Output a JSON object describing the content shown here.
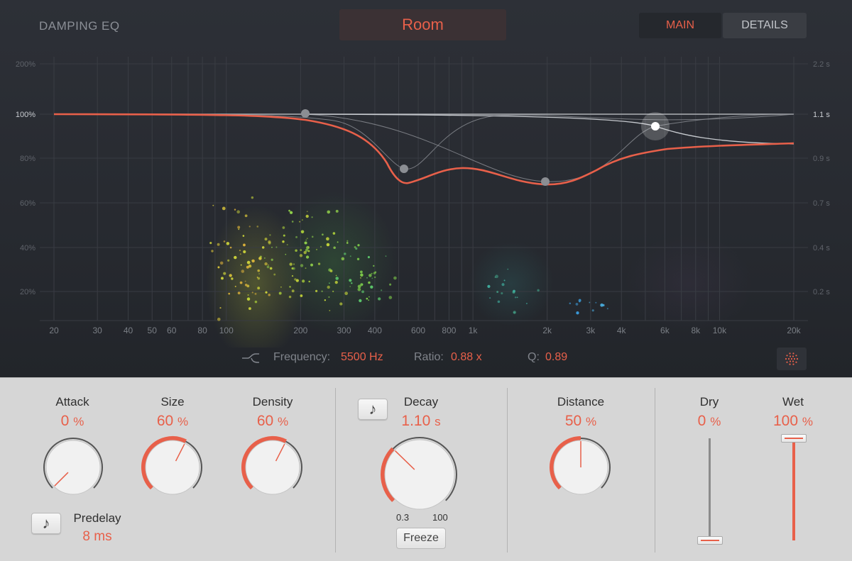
{
  "header": {
    "section_label": "DAMPING EQ",
    "preset_name": "Room",
    "tabs": [
      {
        "label": "MAIN",
        "active": true
      },
      {
        "label": "DETAILS",
        "active": false
      }
    ]
  },
  "eq_display": {
    "y_left_ticks": [
      "200%",
      "100%",
      "80%",
      "60%",
      "40%",
      "20%"
    ],
    "y_right_ticks": [
      "2.2 s",
      "1.1 s",
      "0.9 s",
      "0.7 s",
      "0.4 s",
      "0.2 s"
    ],
    "x_ticks": [
      "20",
      "30",
      "40",
      "50",
      "60",
      "80",
      "100",
      "200",
      "300",
      "400",
      "600",
      "800",
      "1k",
      "2k",
      "3k",
      "4k",
      "6k",
      "8k",
      "10k",
      "20k"
    ],
    "curve_color": "#e8604a"
  },
  "readout": {
    "frequency_label": "Frequency:",
    "frequency_value": "5500 Hz",
    "ratio_label": "Ratio:",
    "ratio_value": "0.88 x",
    "q_label": "Q:",
    "q_value": "0.89",
    "filter_icon": "low-pass-filter-icon",
    "dots_icon": "particle-dots-icon"
  },
  "controls": {
    "attack": {
      "label": "Attack",
      "value": "0",
      "unit": "%",
      "level": 0.0
    },
    "size": {
      "label": "Size",
      "value": "60",
      "unit": "%",
      "level": 0.6
    },
    "density": {
      "label": "Density",
      "value": "60",
      "unit": "%",
      "level": 0.6
    },
    "predelay": {
      "label": "Predelay",
      "value": "8 ms",
      "note_icon": "music-note-icon"
    },
    "decay": {
      "label": "Decay",
      "value": "1.10",
      "unit": "s",
      "level": 0.33,
      "min_label": "0.3",
      "max_label": "100",
      "note_icon": "music-note-icon"
    },
    "freeze": {
      "label": "Freeze"
    },
    "distance": {
      "label": "Distance",
      "value": "50",
      "unit": "%",
      "level": 0.5
    },
    "dry": {
      "label": "Dry",
      "value": "0",
      "unit": "%",
      "level": 0.0
    },
    "wet": {
      "label": "Wet",
      "value": "100",
      "unit": "%",
      "level": 1.0
    }
  },
  "accent_color": "#e8604a"
}
